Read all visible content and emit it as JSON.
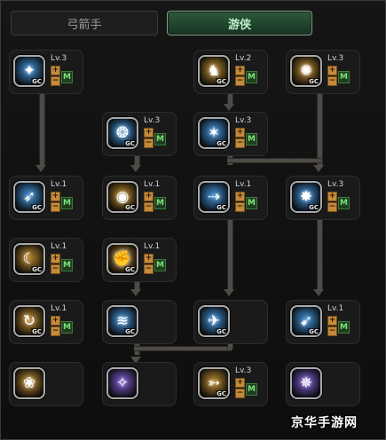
{
  "tabs": [
    {
      "label": "弓箭手",
      "active": false
    },
    {
      "label": "游侠",
      "active": true
    }
  ],
  "accent_color": "#2c5a3a",
  "skills": [
    {
      "id": "r1c1",
      "level": "Lv.3",
      "icon": "swirl-bird-icon",
      "color": "#3e8fd6",
      "glyph": "✦",
      "gc": "GC",
      "plus": "+",
      "minus": "−",
      "m": "M"
    },
    {
      "id": "r1c3",
      "level": "Lv.2",
      "icon": "archer-stance-icon",
      "color": "#b8862a",
      "glyph": "♞",
      "gc": "GC",
      "plus": "+",
      "minus": "−",
      "m": "M"
    },
    {
      "id": "r1c4",
      "level": "Lv.3",
      "icon": "golden-kick-icon",
      "color": "#b8862a",
      "glyph": "✺",
      "gc": "GC",
      "plus": "+",
      "minus": "−",
      "m": "M"
    },
    {
      "id": "r2c2",
      "level": "Lv.3",
      "icon": "wings-shield-icon",
      "color": "#3e8fd6",
      "glyph": "❂",
      "gc": "GC",
      "plus": "+",
      "minus": "−",
      "m": "M"
    },
    {
      "id": "r2c3",
      "level": "Lv.3",
      "icon": "leaping-figure-icon",
      "color": "#3e8fd6",
      "glyph": "✶",
      "gc": "GC",
      "plus": "+",
      "minus": "−",
      "m": "M"
    },
    {
      "id": "r3c1",
      "level": "Lv.1",
      "icon": "aim-shot-icon",
      "color": "#3e8fd6",
      "glyph": "➶",
      "gc": "GC",
      "plus": "+",
      "minus": "−",
      "m": "M"
    },
    {
      "id": "r3c2",
      "level": "Lv.1",
      "icon": "eye-sun-icon",
      "color": "#b8862a",
      "glyph": "◉",
      "gc": "GC",
      "plus": "+",
      "minus": "−",
      "m": "M"
    },
    {
      "id": "r3c3",
      "level": "Lv.1",
      "icon": "dash-figure-icon",
      "color": "#3e8fd6",
      "glyph": "⇢",
      "gc": "GC",
      "plus": "+",
      "minus": "−",
      "m": "M"
    },
    {
      "id": "r3c4",
      "level": "Lv.3",
      "icon": "star-burst-icon",
      "color": "#3e8fd6",
      "glyph": "✸",
      "gc": "GC",
      "plus": "+",
      "minus": "−",
      "m": "M"
    },
    {
      "id": "r4c1",
      "level": "Lv.1",
      "icon": "crescent-strike-icon",
      "color": "#b8862a",
      "glyph": "☾",
      "gc": "GC",
      "plus": "+",
      "minus": "−",
      "m": "M"
    },
    {
      "id": "r4c2",
      "level": "Lv.1",
      "icon": "fire-fist-icon",
      "color": "#b8862a",
      "glyph": "✊",
      "gc": "GC",
      "plus": "+",
      "minus": "−",
      "m": "M"
    },
    {
      "id": "r5c1",
      "level": "Lv.1",
      "icon": "spin-kick-icon",
      "color": "#b8862a",
      "glyph": "↻",
      "gc": "GC",
      "plus": "+",
      "minus": "−",
      "m": "M"
    },
    {
      "id": "r5c2",
      "level": "",
      "icon": "wind-slash-icon",
      "color": "#3e8fd6",
      "glyph": "≋",
      "gc": "GC",
      "plus": "",
      "minus": "",
      "m": ""
    },
    {
      "id": "r5c3",
      "level": "",
      "icon": "runner-icon",
      "color": "#3e8fd6",
      "glyph": "✈",
      "gc": "GC",
      "plus": "",
      "minus": "",
      "m": ""
    },
    {
      "id": "r5c4",
      "level": "Lv.1",
      "icon": "flying-kick-icon",
      "color": "#3e8fd6",
      "glyph": "➹",
      "gc": "GC",
      "plus": "+",
      "minus": "−",
      "m": "M"
    },
    {
      "id": "r6c1",
      "level": "",
      "icon": "golden-coil-icon",
      "color": "#b8862a",
      "glyph": "❀",
      "gc": "",
      "plus": "",
      "minus": "",
      "m": ""
    },
    {
      "id": "r6c2",
      "level": "",
      "icon": "purple-spark-icon",
      "color": "#7a5ad0",
      "glyph": "✧",
      "gc": "",
      "plus": "",
      "minus": "",
      "m": ""
    },
    {
      "id": "r6c3",
      "level": "Lv.3",
      "icon": "golden-bow-icon",
      "color": "#b8862a",
      "glyph": "➳",
      "gc": "GC",
      "plus": "+",
      "minus": "−",
      "m": "M"
    },
    {
      "id": "r6c4",
      "level": "",
      "icon": "purple-storm-icon",
      "color": "#7a5ad0",
      "glyph": "✵",
      "gc": "",
      "plus": "",
      "minus": "",
      "m": ""
    }
  ],
  "watermark": "京华手游网"
}
